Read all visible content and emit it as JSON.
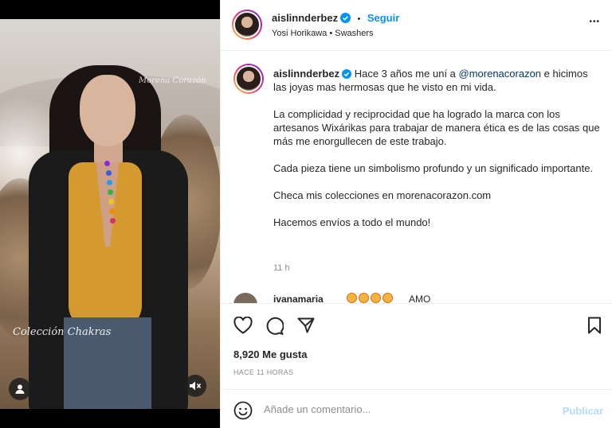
{
  "post": {
    "username": "aislinnderbez",
    "follow_label": "Seguir",
    "separator": "•",
    "audio_line": "Yosi Horikawa • Swashers",
    "more_label": "•••"
  },
  "media": {
    "watermark_top": "Morena Corazón",
    "watermark_bottom": "Colección Chakras"
  },
  "caption": {
    "username": "aislinnderbez",
    "text_before": "Hace 3 años me uní a ",
    "mention": "@morenacorazon",
    "text_after": " e hicimos las joyas mas hermosas que he visto en mi vida.\n\nLa complicidad y reciprocidad que ha logrado la marca con los artesanos Wixárikas para trabajar de manera ética es de las cosas que más me enorgullecen de este trabajo.\n\nCada pieza tiene un simbolismo profundo y un significado importante.\n\nCheca mis colecciones en morenacorazon.com\n\nHacemos envíos a todo el mundo!",
    "time": "11 h"
  },
  "peek_comment": {
    "username": "ivanamaria",
    "text": "AMO"
  },
  "stats": {
    "likes": "8,920 Me gusta",
    "posted": "HACE 11 HORAS"
  },
  "composer": {
    "placeholder": "Añade un comentario...",
    "submit_label": "Publicar"
  },
  "colors": {
    "link": "#0095f6",
    "mention": "#00376b",
    "publish_disabled": "#b3dbff"
  }
}
